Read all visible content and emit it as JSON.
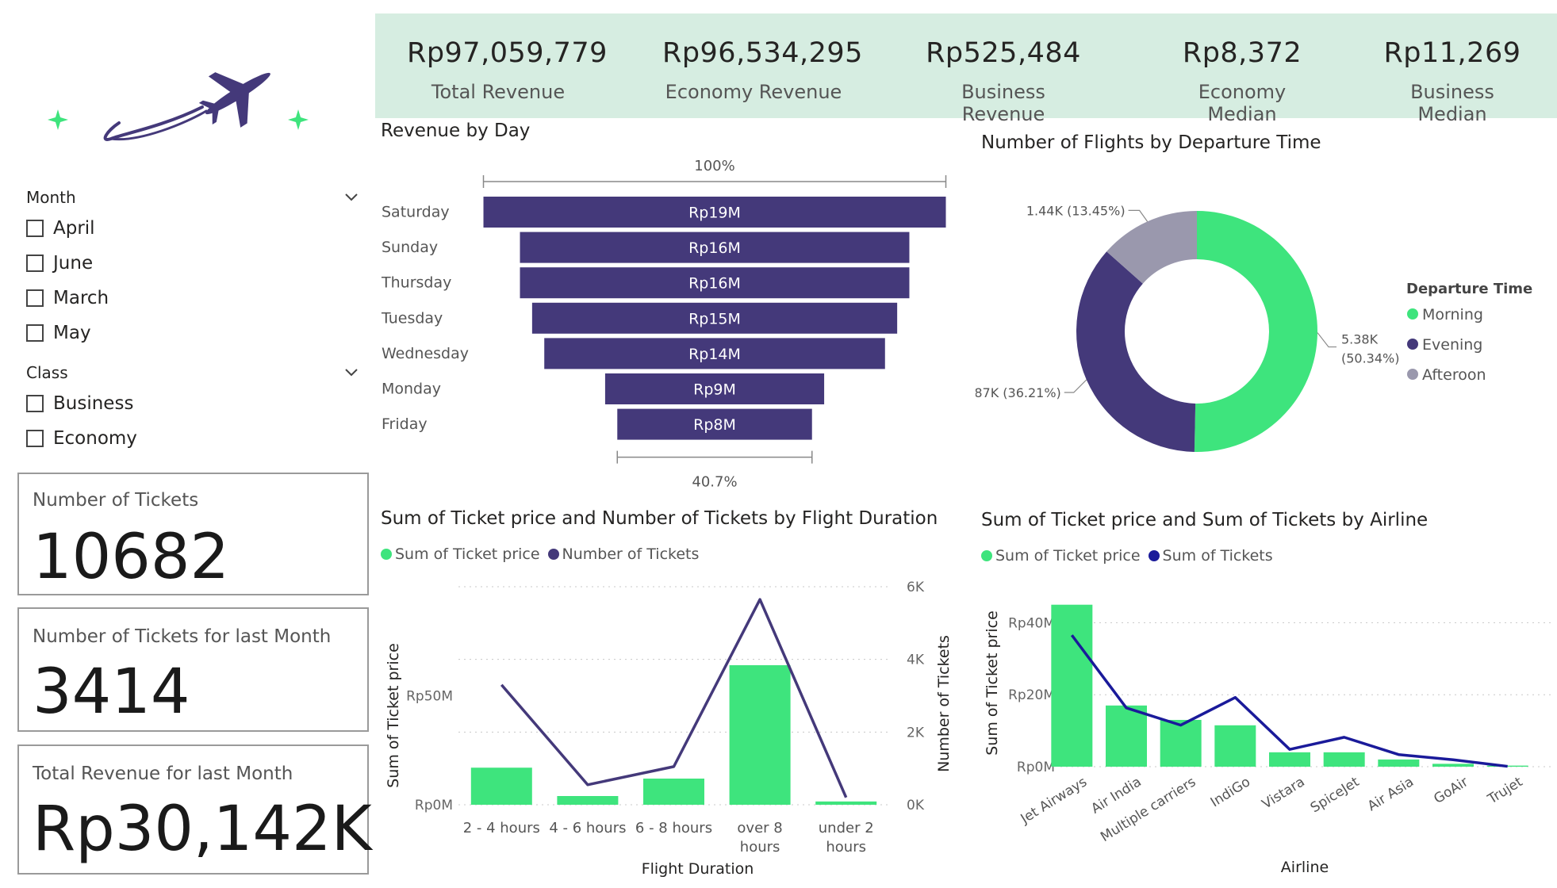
{
  "kpis": [
    {
      "value": "Rp97,059,779",
      "label": "Total Revenue"
    },
    {
      "value": "Rp96,534,295",
      "label": "Economy Revenue"
    },
    {
      "value": "Rp525,484",
      "label": "Business Revenue"
    },
    {
      "value": "Rp8,372",
      "label": "Economy Median"
    },
    {
      "value": "Rp11,269",
      "label": "Business Median"
    }
  ],
  "slicers": {
    "month": {
      "title": "Month",
      "options": [
        "April",
        "June",
        "March",
        "May"
      ]
    },
    "class": {
      "title": "Class",
      "options": [
        "Business",
        "Economy"
      ]
    }
  },
  "cards": [
    {
      "title": "Number of Tickets",
      "value": "10682"
    },
    {
      "title": "Number of Tickets for last Month",
      "value": "3414"
    },
    {
      "title": "Total Revenue for last Month",
      "value": "Rp30,142K"
    }
  ],
  "colors": {
    "green": "#3ee47d",
    "purple": "#44397a",
    "gray": "#9a98ad",
    "navy": "#1a1a9a",
    "banner": "#d6ede1",
    "sparkle": "#3ee47d"
  },
  "icons": {
    "logo": "airplane-icon",
    "sparkle": "sparkle-icon",
    "chevron": "chevron-down-icon"
  },
  "chart_data": [
    {
      "type": "bar",
      "subtype": "funnel",
      "title": "Revenue by Day",
      "categories": [
        "Saturday",
        "Sunday",
        "Thursday",
        "Tuesday",
        "Wednesday",
        "Monday",
        "Friday"
      ],
      "values": [
        19,
        16,
        16,
        15,
        14,
        9,
        8
      ],
      "labels": [
        "Rp19M",
        "Rp16M",
        "Rp16M",
        "Rp15M",
        "Rp14M",
        "Rp9M",
        "Rp8M"
      ],
      "relative_widths": [
        100,
        81.8,
        81.8,
        78.3,
        73.9,
        45.6,
        40.7
      ],
      "top_annotation": "100%",
      "bottom_annotation": "40.7%"
    },
    {
      "type": "pie",
      "subtype": "donut",
      "title": "Number of Flights by Departure Time",
      "legend_title": "Departure Time",
      "legend_position": "right",
      "slices": [
        {
          "name": "Morning",
          "value": 5380,
          "label": "5.38K",
          "percent_label": "(50.34%)"
        },
        {
          "name": "Evening",
          "value": 3870,
          "label": "3.87K (36.21%)"
        },
        {
          "name": "Afteroon",
          "value": 1440,
          "label": "1.44K (13.45%)"
        }
      ]
    },
    {
      "type": "bar",
      "subtype": "combo-bar-line",
      "title": "Sum of Ticket price and Number of Tickets by Flight Duration",
      "legend_position": "top-left",
      "xlabel": "Flight Duration",
      "ylabel": "Sum of Ticket price",
      "y2label": "Number of Tickets",
      "categories": [
        "2 - 4 hours",
        "4 - 6 hours",
        "6 - 8 hours",
        "over 8 hours",
        "under 2 hours"
      ],
      "category_lines": [
        [
          "2 - 4 hours"
        ],
        [
          "4 - 6 hours"
        ],
        [
          "6 - 8 hours"
        ],
        [
          "over 8",
          "hours"
        ],
        [
          "under 2",
          "hours"
        ]
      ],
      "ylim": [
        0,
        100
      ],
      "y2lim": [
        0,
        6000
      ],
      "yticks": [
        {
          "value": 0,
          "label": "Rp0M"
        },
        {
          "value": 50,
          "label": "Rp50M"
        }
      ],
      "y2ticks": [
        {
          "value": 0,
          "label": "0K"
        },
        {
          "value": 2000,
          "label": "2K"
        },
        {
          "value": 4000,
          "label": "4K"
        },
        {
          "value": 6000,
          "label": "6K"
        }
      ],
      "series": [
        {
          "name": "Sum of Ticket price",
          "type": "bar",
          "values": [
            17,
            4,
            12,
            64,
            1.5
          ]
        },
        {
          "name": "Number of Tickets",
          "type": "line",
          "values": [
            3300,
            550,
            1050,
            5650,
            200
          ]
        }
      ]
    },
    {
      "type": "bar",
      "subtype": "combo-bar-line",
      "title": "Sum of Ticket price and Sum of Tickets by Airline",
      "legend_position": "top-left",
      "xlabel": "Airline",
      "ylabel": "Sum of Ticket price",
      "categories": [
        "Jet Airways",
        "Air India",
        "Multiple carriers",
        "IndiGo",
        "Vistara",
        "SpiceJet",
        "Air Asia",
        "GoAir",
        "Trujet"
      ],
      "ylim": [
        0,
        50
      ],
      "yticks": [
        {
          "value": 0,
          "label": "Rp0M"
        },
        {
          "value": 20,
          "label": "Rp20M"
        },
        {
          "value": 40,
          "label": "Rp40M"
        }
      ],
      "series": [
        {
          "name": "Sum of Ticket price",
          "type": "bar",
          "values": [
            45,
            17,
            13,
            11.5,
            4,
            4,
            2,
            0.8,
            0.3
          ]
        },
        {
          "name": "Sum of Tickets",
          "type": "line",
          "values": [
            3800,
            1700,
            1200,
            2000,
            500,
            850,
            350,
            200,
            10
          ]
        }
      ]
    }
  ]
}
